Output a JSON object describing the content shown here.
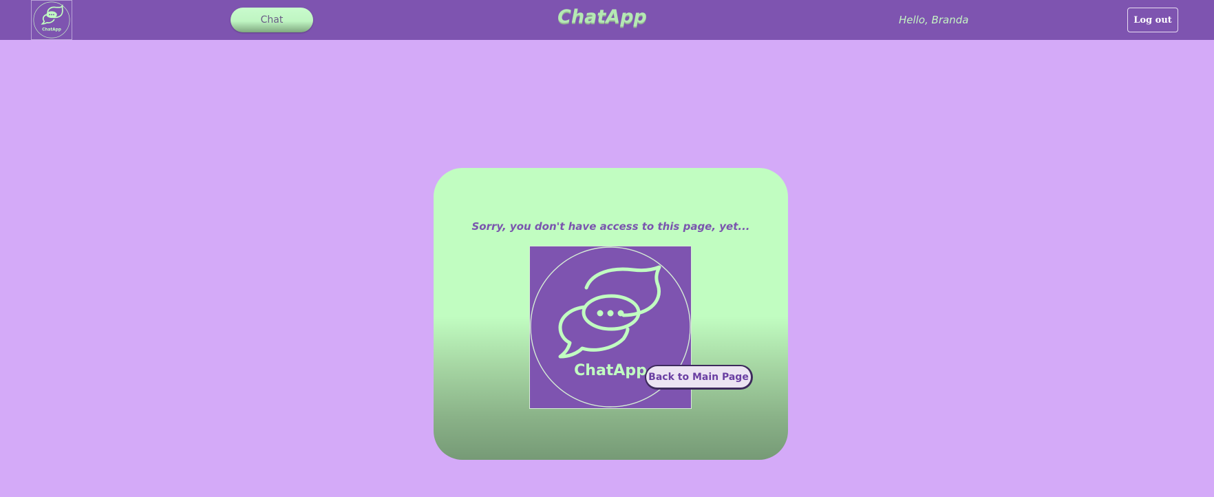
{
  "navbar": {
    "logo": {
      "icon": "chatapp-logo-icon",
      "text": "ChatApp"
    },
    "chat_label": "Chat",
    "app_title": "ChatApp",
    "greeting": "Hello, Branda",
    "logout_label": "Log out"
  },
  "main": {
    "message": "Sorry, you don't have access to this page, yet...",
    "logo": {
      "icon": "chatapp-logo-icon",
      "text": "ChatApp"
    },
    "back_label": "Back to Main Page"
  },
  "colors": {
    "page_background": "#d4aaf8",
    "navbar": "#7e54b0",
    "card_green": "#c1fdc1",
    "accent_text": "#7a55ae"
  }
}
